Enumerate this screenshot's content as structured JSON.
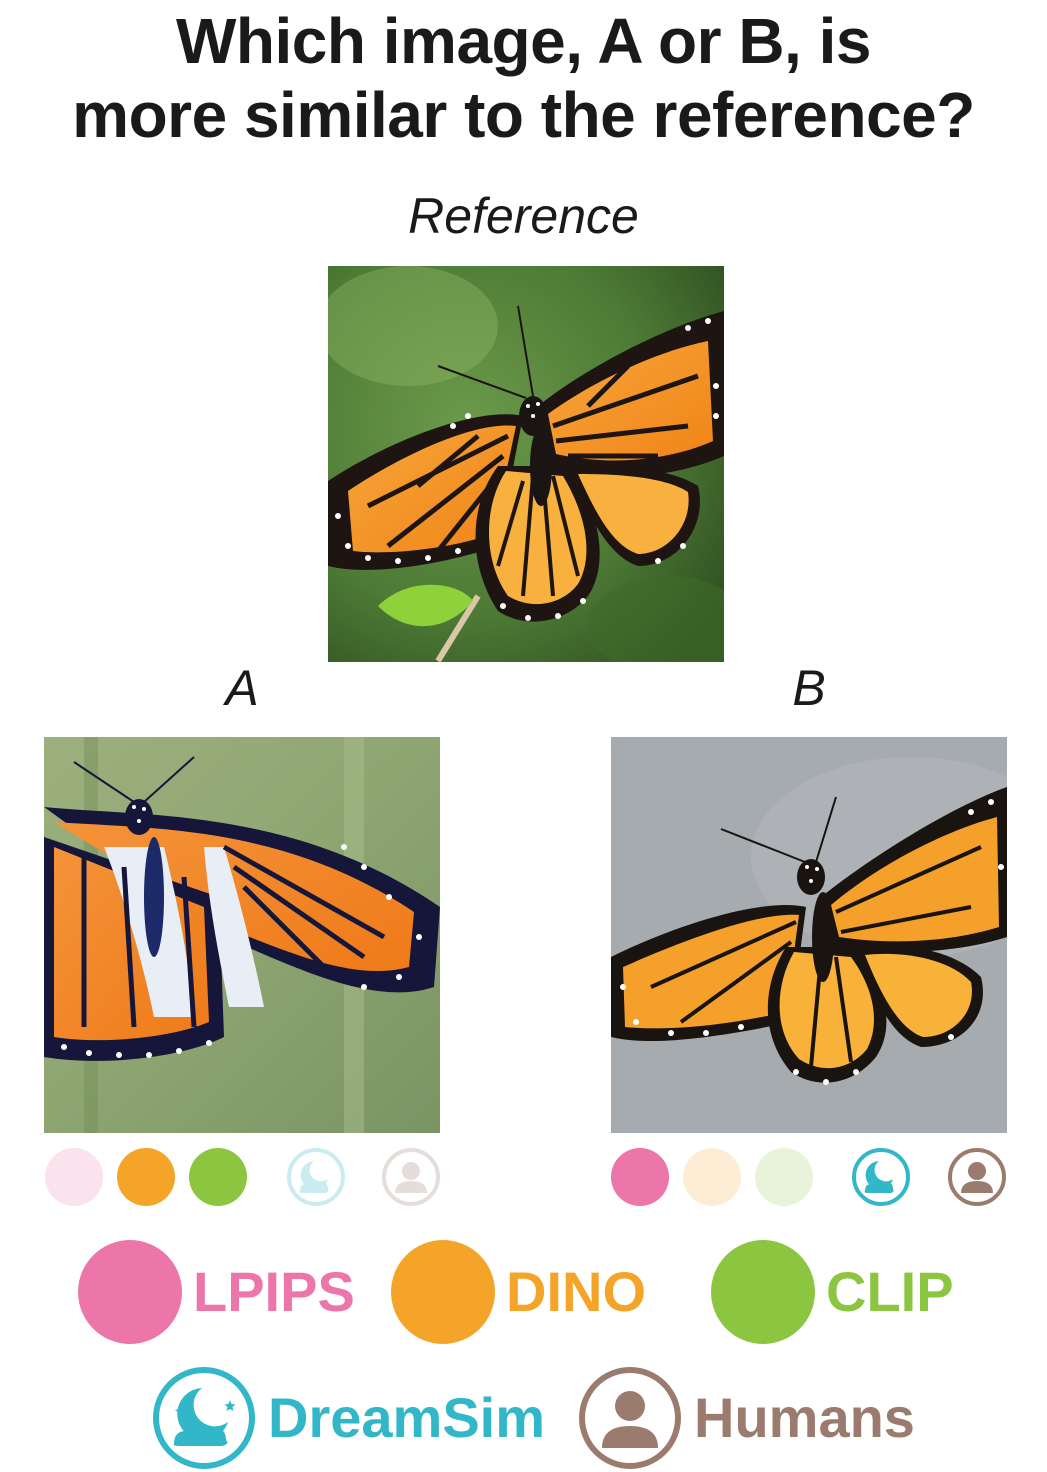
{
  "title_line1": "Which image, A or B, is",
  "title_line2": "more similar to the reference?",
  "labels": {
    "reference": "Reference",
    "a": "A",
    "b": "B"
  },
  "colors": {
    "lpips": "#ec75aa",
    "dino": "#f5a42a",
    "clip": "#8cc540",
    "dreamsim": "#31b7c8",
    "humans": "#9b7b6e"
  },
  "votes": {
    "a": {
      "lpips": false,
      "dino": true,
      "clip": true,
      "dreamsim": false,
      "humans": false
    },
    "b": {
      "lpips": true,
      "dino": false,
      "clip": false,
      "dreamsim": true,
      "humans": true
    }
  },
  "legend": {
    "lpips": "LPIPS",
    "dino": "DINO",
    "clip": "CLIP",
    "dreamsim": "DreamSim",
    "humans": "Humans"
  },
  "icons": {
    "dreamsim": "moon-cloud-icon",
    "humans": "person-icon"
  }
}
